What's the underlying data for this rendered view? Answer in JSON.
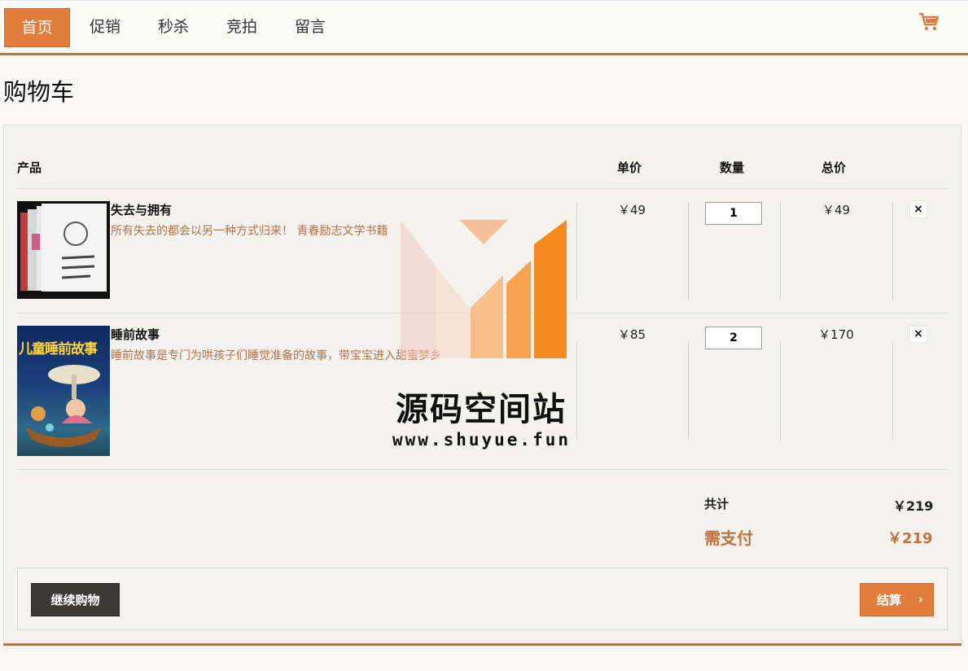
{
  "nav": {
    "items": [
      {
        "label": "首页",
        "active": true
      },
      {
        "label": "促销",
        "active": false
      },
      {
        "label": "秒杀",
        "active": false
      },
      {
        "label": "竞拍",
        "active": false
      },
      {
        "label": "留言",
        "active": false
      }
    ],
    "cart_icon": "shopping-cart-icon"
  },
  "page_title": "购物车",
  "table": {
    "headers": {
      "product": "产品",
      "unit_price": "单价",
      "quantity": "数量",
      "total": "总价"
    },
    "rows": [
      {
        "name": "失去与拥有",
        "desc": "所有失去的都会以另一种方式归来！ 青春励志文学书籍",
        "unit_price": "￥49",
        "quantity": "1",
        "total": "￥49",
        "remove": "×"
      },
      {
        "name": "睡前故事",
        "desc": "睡前故事是专门为哄孩子们睡觉准备的故事，带宝宝进入甜蜜梦乡",
        "unit_price": "￥85",
        "quantity": "2",
        "total": "￥170",
        "remove": "×",
        "cover_title": "儿童睡前故事"
      }
    ]
  },
  "summary": {
    "total_label": "共计",
    "total_value": "￥219",
    "pay_label": "需支付",
    "pay_value": "￥219"
  },
  "actions": {
    "continue_label": "继续购物",
    "checkout_label": "结算",
    "checkout_chevron": "›"
  },
  "watermark": {
    "name": "源码空间站",
    "url": "www.shuyue.fun"
  },
  "colors": {
    "accent": "#e37d3d",
    "accent_dark": "#c0703c",
    "desc_text": "#b8703f",
    "dark_button": "#3d3a36"
  }
}
